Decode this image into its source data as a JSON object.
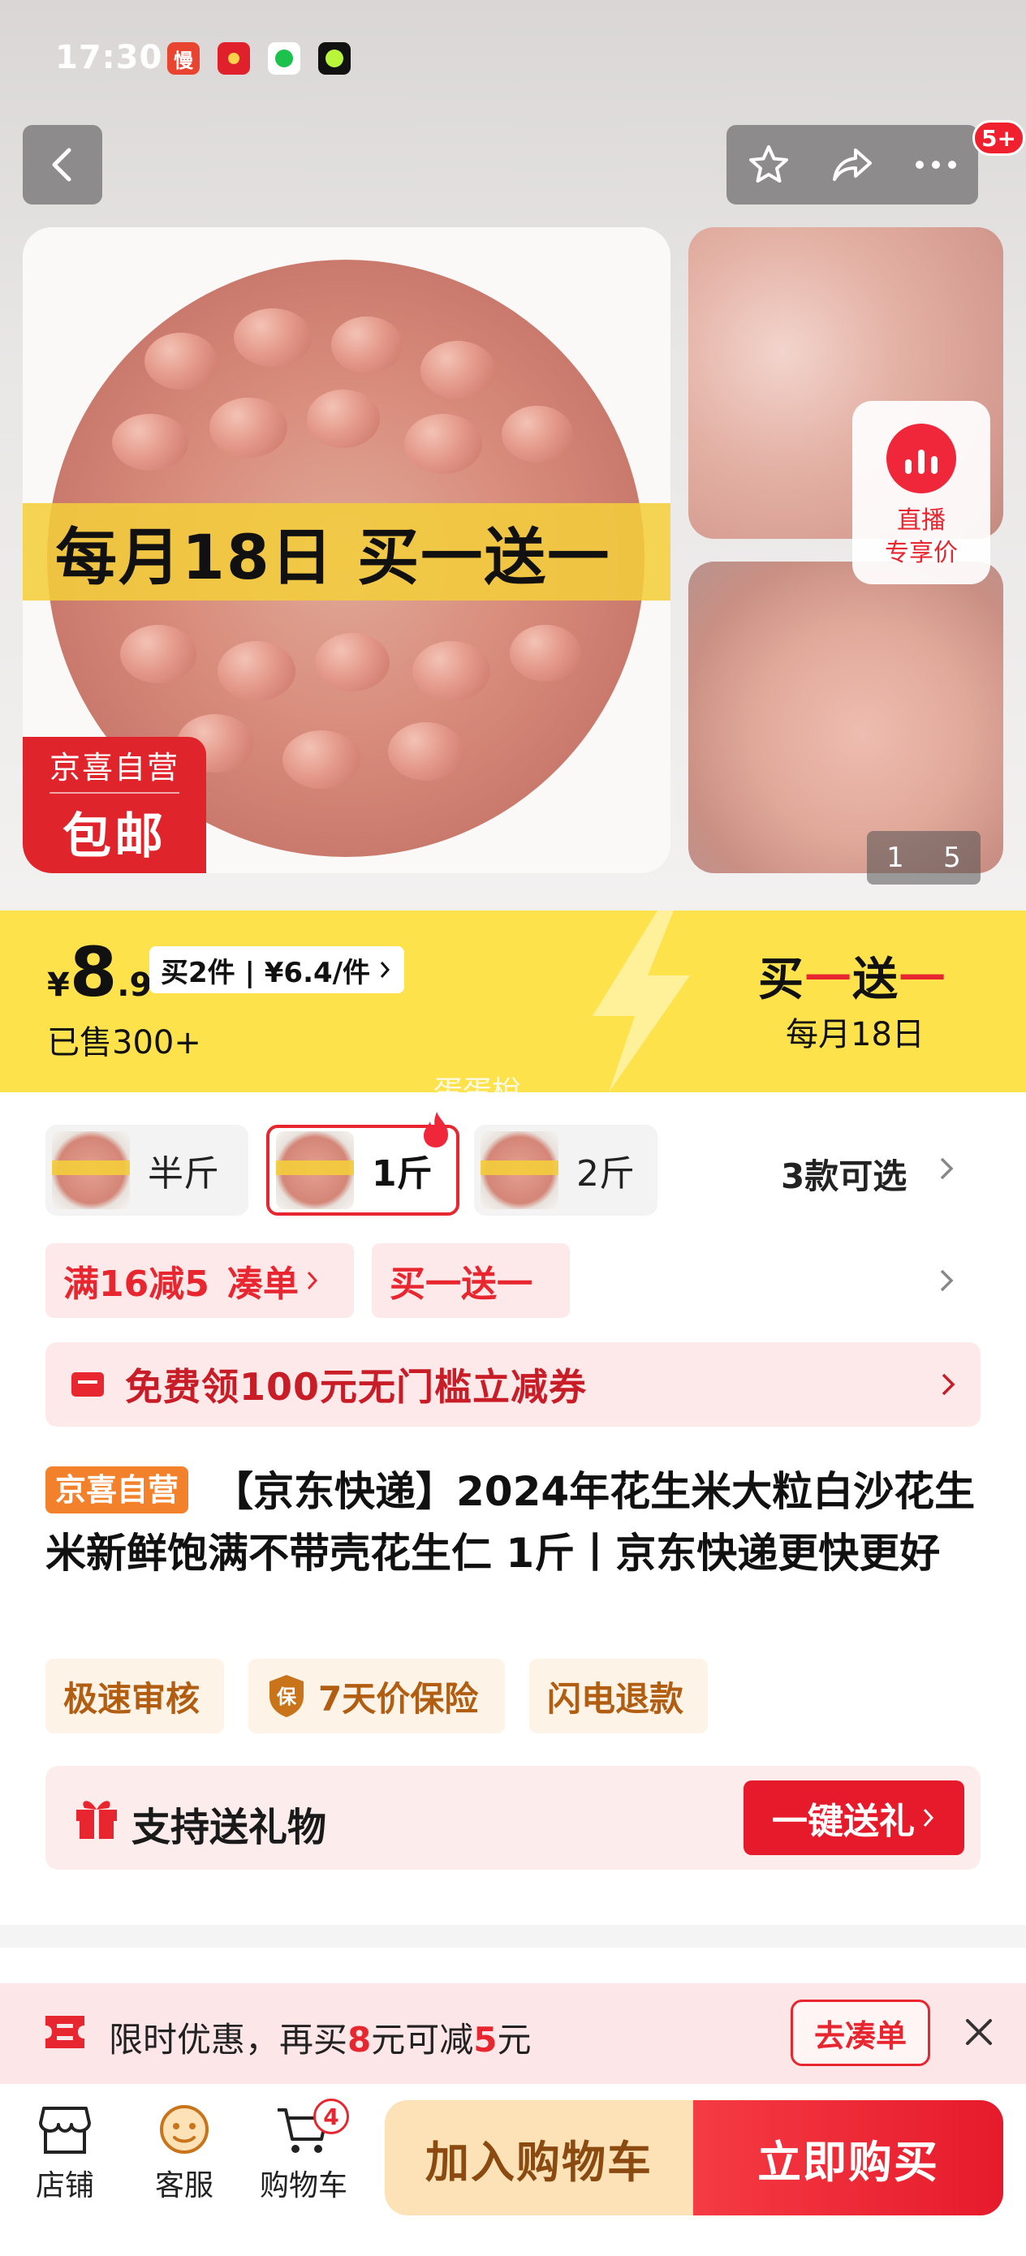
{
  "status_bar": {
    "time": "17:30",
    "app_icons": [
      "manhua-app-icon",
      "red-envelope-app-icon",
      "message-app-icon",
      "camera-app-icon"
    ],
    "app_icon_label_1": "慢"
  },
  "header": {
    "message_badge": "5+"
  },
  "gallery": {
    "main_promo": "每月18日 买一送一",
    "badge_line1": "京喜自营",
    "badge_line2": "包邮",
    "live_label_1": "直播",
    "live_label_2": "专享价",
    "page_current": "1",
    "page_total": "5"
  },
  "price_bar": {
    "currency": "¥",
    "price_int": "8",
    "price_dec": ".9",
    "multi_buy": "买2件 | ¥6.4/件",
    "sold": "已售300+",
    "bogo_part1": "买",
    "bogo_part2": "一",
    "bogo_part3": "送",
    "bogo_part4": "一",
    "bogo_date": "每月18日",
    "watermark": "蛋蛋梲",
    "accent_color": "#fde24c"
  },
  "sku": {
    "options": [
      {
        "label": "半斤"
      },
      {
        "label": "1斤"
      },
      {
        "label": "2斤"
      }
    ],
    "selected_index": 1,
    "count_label": "3款可选"
  },
  "promos": {
    "full_reduce": "满16减5",
    "full_reduce_action": "凑单",
    "bogo": "买一送一",
    "coupon": "免费领100元无门槛立减券"
  },
  "product": {
    "self_tag": "京喜自营",
    "title": "【京东快递】2024年花生米大粒白沙花生米新鲜饱满不带壳花生仁 1斤丨京东快递更快更好",
    "services": [
      "极速审核",
      "7天价保险",
      "闪电退款"
    ],
    "shield_char": "保"
  },
  "gift": {
    "label": "支持送礼物",
    "button": "一键送礼"
  },
  "limit_banner": {
    "text_prefix": "限时优惠，再买",
    "amount_1": "8",
    "text_mid": "元可减",
    "amount_2": "5",
    "text_suffix": "元",
    "button": "去凑单"
  },
  "bottom_nav": {
    "shop": "店铺",
    "service": "客服",
    "cart": "购物车",
    "cart_count": "4",
    "add_to_cart": "加入购物车",
    "buy_now": "立即购买",
    "brand_red": "#e61a2b"
  }
}
